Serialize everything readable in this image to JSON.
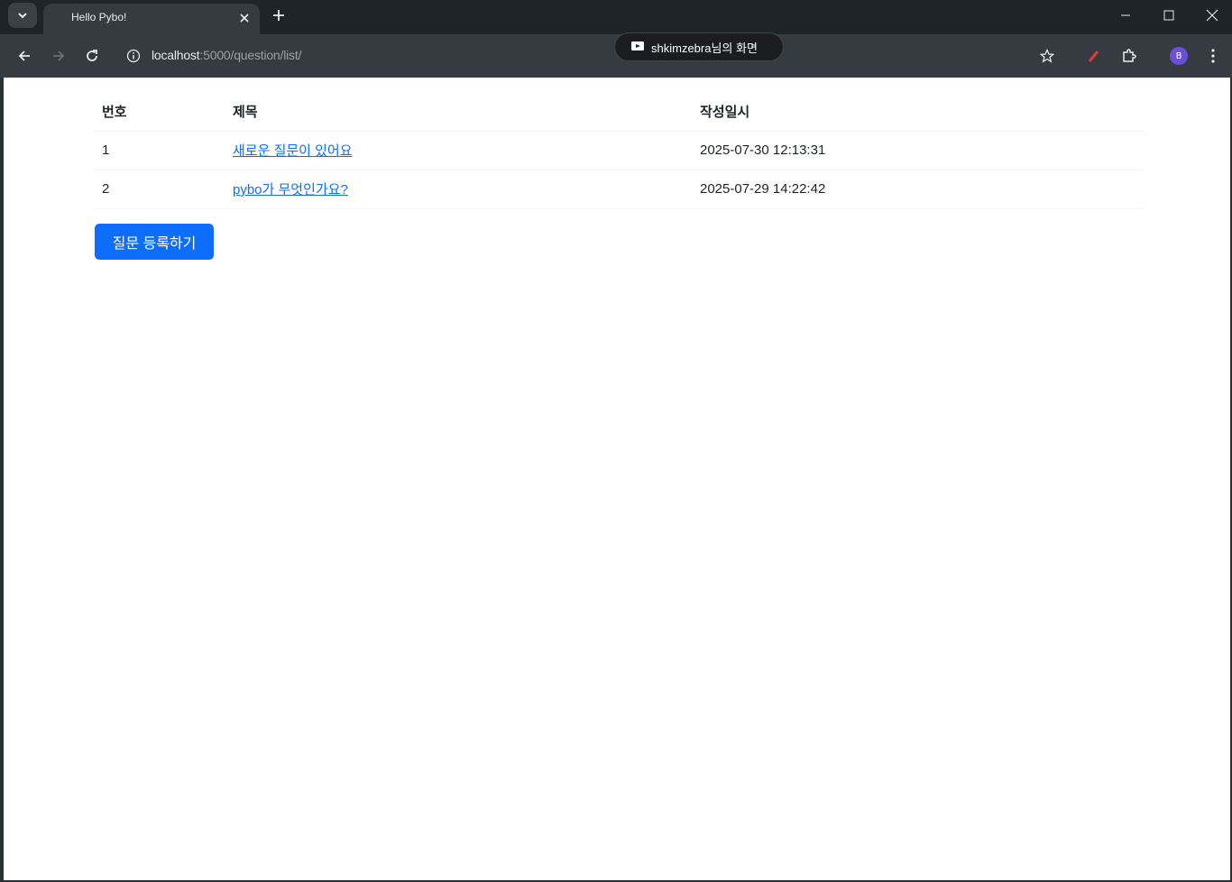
{
  "browser": {
    "tab_title": "Hello Pybo!",
    "url_host": "localhost",
    "url_path": ":5000/question/list/",
    "share_indicator": "shkimzebra님의 화면",
    "profile_initial": "B"
  },
  "table": {
    "headers": {
      "number": "번호",
      "subject": "제목",
      "created": "작성일시"
    },
    "rows": [
      {
        "number": "1",
        "subject": "새로운 질문이 있어요",
        "created": "2025-07-30 12:13:31"
      },
      {
        "number": "2",
        "subject": "pybo가 무엇인가요?",
        "created": "2025-07-29 14:22:42"
      }
    ]
  },
  "actions": {
    "create_question": "질문 등록하기"
  },
  "colors": {
    "primary": "#0d6efd",
    "chrome_dark": "#1f2428",
    "chrome_toolbar": "#353b41"
  }
}
